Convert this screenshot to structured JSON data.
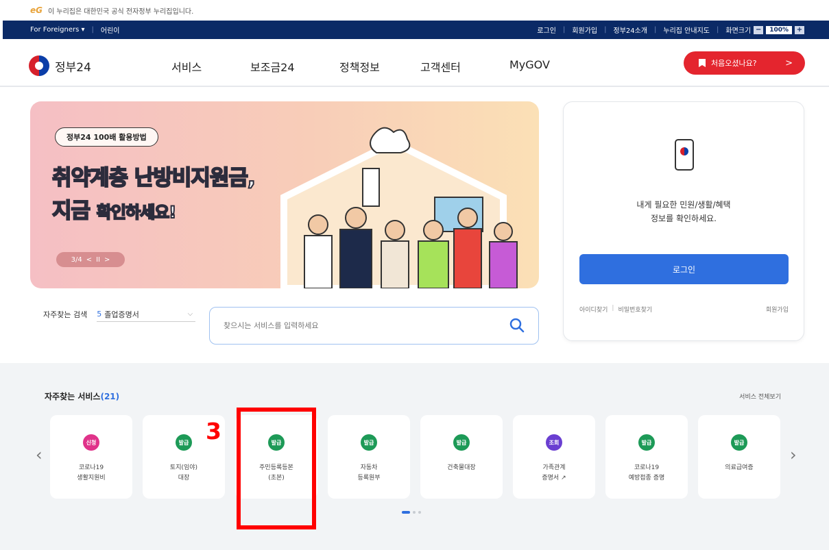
{
  "gov_strip": {
    "logo": "eG",
    "text": "이 누리집은 대한민국 공식 전자정부 누리집입니다."
  },
  "utilbar": {
    "foreigners": "For Foreigners ▾",
    "kids": "어린이",
    "login": "로그인",
    "join": "회원가입",
    "about": "정부24소개",
    "sitemap": "누리집 안내지도",
    "fontsize_label": "화면크기",
    "fontsize_minus": "−",
    "fontsize_value": "100%",
    "fontsize_plus": "+"
  },
  "header": {
    "logo_text": "정부24",
    "menu": [
      "서비스",
      "보조금24",
      "정책정보",
      "고객센터",
      "MyGOV"
    ],
    "first_visit": "처음오셨나요?",
    "first_visit_arrow": ">"
  },
  "banner": {
    "chip": "정부24 100배 활용방법",
    "headline1": "취약계층 난방비지원금,",
    "headline2_big": "지금",
    "headline2_small": "확인하세요!",
    "pager": "3/4",
    "pager_prev": "<",
    "pager_pause": "II",
    "pager_next": ">"
  },
  "login_card": {
    "message_line1": "내게 필요한 민원/생활/혜택",
    "message_line2": "정보를 확인하세요.",
    "login_button": "로그인",
    "find_id": "아이디찾기",
    "find_pw": "비밀번호찾기",
    "join": "회원가입"
  },
  "search": {
    "label": "자주찾는 검색",
    "keyword_num": "5",
    "keyword": "졸업증명서",
    "placeholder": "찾으시는 서비스를 입력하세요"
  },
  "services": {
    "title": "자주찾는 서비스",
    "count": "(21)",
    "view_all": "서비스 전체보기",
    "items": [
      {
        "badge": "신청",
        "badge_color": "#e0338a",
        "line1": "코로나19",
        "line2": "생활지원비",
        "line3": ""
      },
      {
        "badge": "발급",
        "badge_color": "#1d9a57",
        "line1": "토지(임야)",
        "line2": "대장",
        "line3": ""
      },
      {
        "badge": "발급",
        "badge_color": "#1d9a57",
        "line1": "주민등록등본",
        "line2": "(초본)",
        "line3": ""
      },
      {
        "badge": "발급",
        "badge_color": "#1d9a57",
        "line1": "자동차",
        "line2": "등록원부",
        "line3": ""
      },
      {
        "badge": "발급",
        "badge_color": "#1d9a57",
        "line1": "건축물대장",
        "line2": "",
        "line3": ""
      },
      {
        "badge": "조회",
        "badge_color": "#6a3fd1",
        "line1": "가족관계",
        "line2": "증명서 ↗",
        "line3": ""
      },
      {
        "badge": "발급",
        "badge_color": "#1d9a57",
        "line1": "코로나19",
        "line2": "예방접종 증명",
        "line3": ""
      },
      {
        "badge": "발급",
        "badge_color": "#1d9a57",
        "line1": "의료급여증",
        "line2": "",
        "line3": ""
      }
    ]
  },
  "annotation": {
    "number": "3"
  }
}
